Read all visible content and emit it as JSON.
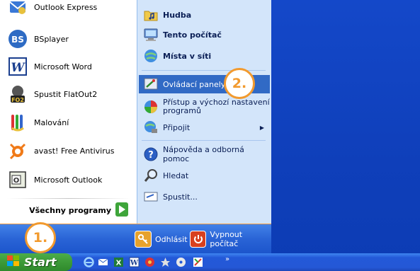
{
  "start_menu": {
    "programs": [
      {
        "label": "Outlook Express",
        "icon": "outlook-express-icon"
      },
      {
        "label": "BSplayer",
        "icon": "bsplayer-icon"
      },
      {
        "label": "Microsoft Word",
        "icon": "word-icon"
      },
      {
        "label": "Spustit FlatOut2",
        "icon": "flatout2-icon"
      },
      {
        "label": "Malování",
        "icon": "paint-icon"
      },
      {
        "label": "avast! Free Antivirus",
        "icon": "avast-icon"
      },
      {
        "label": "Microsoft Outlook",
        "icon": "outlook-icon"
      }
    ],
    "all_programs_label": "Všechny programy",
    "places": [
      {
        "label": "Hudba",
        "icon": "music-folder-icon"
      },
      {
        "label": "Tento počítač",
        "icon": "my-computer-icon"
      },
      {
        "label": "Místa v síti",
        "icon": "network-places-icon"
      },
      {
        "label": "Ovládací panely",
        "icon": "control-panel-icon"
      },
      {
        "label": "Přístup a výchozí nastavení programů",
        "icon": "program-access-icon"
      },
      {
        "label": "Připojit",
        "icon": "connect-icon"
      },
      {
        "label": "Nápověda a odborná pomoc",
        "icon": "help-icon"
      },
      {
        "label": "Hledat",
        "icon": "search-icon"
      },
      {
        "label": "Spustit...",
        "icon": "run-icon"
      }
    ],
    "logoff_label": "Odhlásit",
    "shutdown_label": "Vypnout počítač"
  },
  "taskbar": {
    "start_label": "Start",
    "chevron": "»"
  },
  "callouts": {
    "step1": "1.",
    "step2": "2."
  },
  "colors": {
    "desktop": "#1448c9",
    "highlight": "#316ac5",
    "callout": "#f29a2e",
    "start_green": "#3c9a38"
  }
}
